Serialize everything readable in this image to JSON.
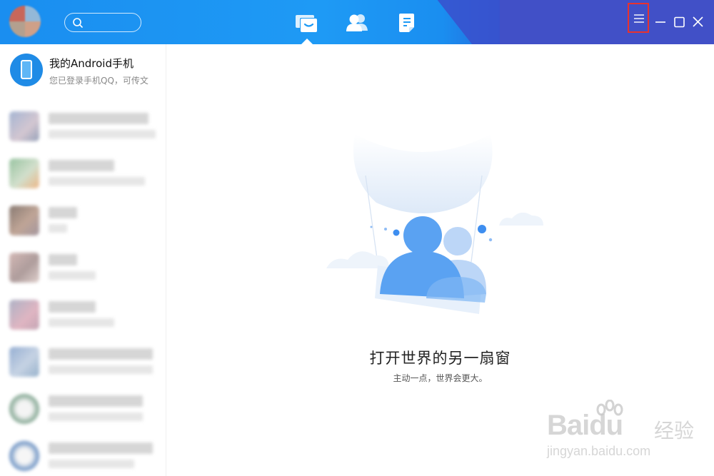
{
  "colors": {
    "titlebar": "#1e9af5",
    "titlebar_right": "#4150c7",
    "highlight_box": "#e8322e",
    "device_icon": "#1f8be6"
  },
  "titlebar": {
    "icons": [
      "user-avatar",
      "search-icon",
      "messages-tab-icon",
      "contacts-tab-icon",
      "notes-tab-icon",
      "hamburger-menu-icon",
      "minimize-icon",
      "maximize-icon",
      "close-icon"
    ]
  },
  "sidebar": {
    "device": {
      "name": "我的Android手机",
      "status": "您已登录手机QQ，可传文"
    }
  },
  "main": {
    "empty_title": "打开世界的另一扇窗",
    "empty_subtitle": "主动一点，世界会更大。"
  },
  "watermark": {
    "logo": "Bai",
    "logo_du": "du",
    "logo_cn": "经验",
    "url": "jingyan.baidu.com"
  }
}
